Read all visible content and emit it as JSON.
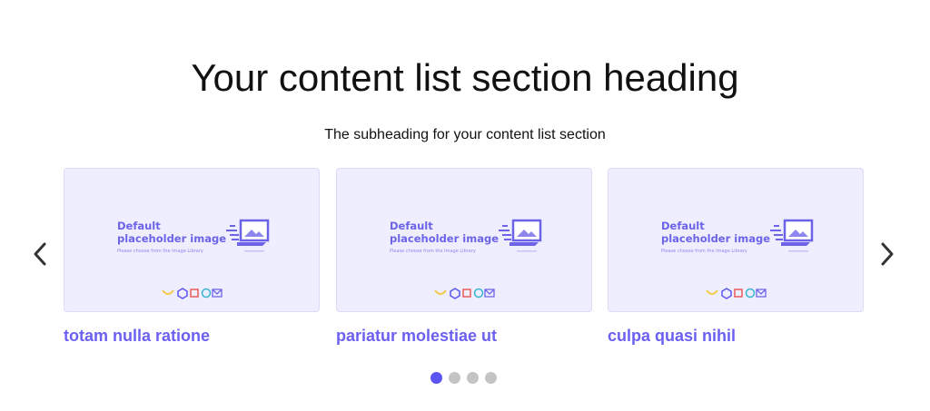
{
  "section": {
    "heading": "Your content list section heading",
    "subheading": "The subheading for your content list section"
  },
  "carousel": {
    "prev_icon": "chevron-left-icon",
    "next_icon": "chevron-right-icon",
    "cards": [
      {
        "placeholder_title": "Default\nplaceholder image",
        "placeholder_note": "Please choose from the Image Library",
        "title": "totam nulla ratione"
      },
      {
        "placeholder_title": "Default\nplaceholder image",
        "placeholder_note": "Please choose from the Image Library",
        "title": "pariatur molestiae ut"
      },
      {
        "placeholder_title": "Default\nplaceholder image",
        "placeholder_note": "Please choose from the Image Library",
        "title": "culpa quasi nihil"
      }
    ],
    "pagination": {
      "total": 4,
      "active": 1
    }
  },
  "colors": {
    "accent": "#5b54f2",
    "card_title": "#6c60f0",
    "card_bg": "#efeefe",
    "dot_inactive": "#c4c4c4"
  }
}
